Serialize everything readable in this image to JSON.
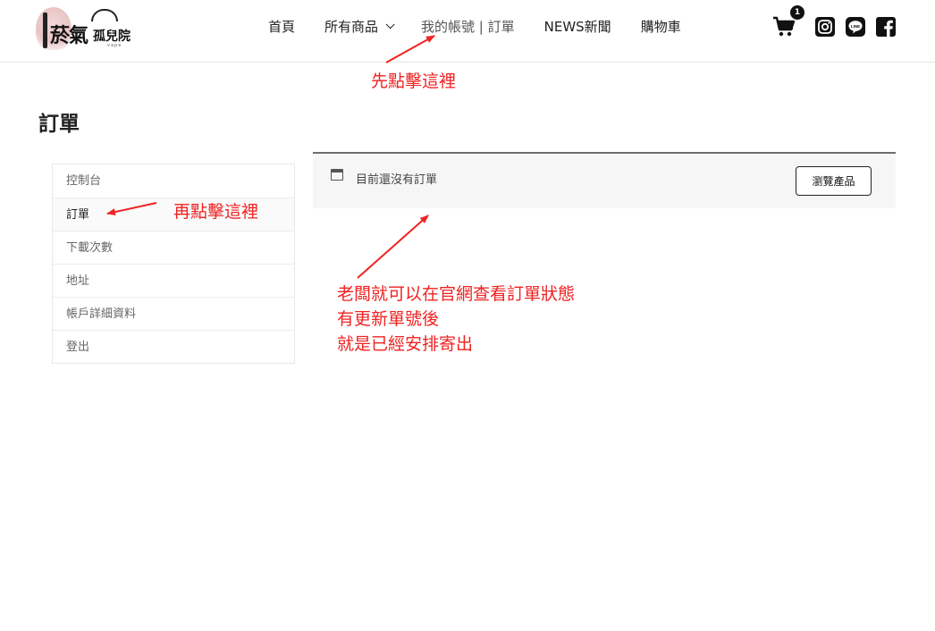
{
  "header": {
    "logo": {
      "title": "菸氣",
      "subtitle": "孤兒院",
      "tagline": "vape"
    },
    "nav": [
      {
        "label": "首頁"
      },
      {
        "label": "所有商品",
        "has_dropdown": true
      },
      {
        "label": "我的帳號 | 訂單",
        "active": true
      },
      {
        "label": "NEWS新聞"
      },
      {
        "label": "購物車"
      }
    ],
    "cart_count": "1",
    "icons": [
      "cart-icon",
      "instagram-icon",
      "line-icon",
      "facebook-icon"
    ]
  },
  "page": {
    "title": "訂單"
  },
  "account_nav": {
    "items": [
      {
        "label": "控制台"
      },
      {
        "label": "訂單",
        "active": true
      },
      {
        "label": "下載次數"
      },
      {
        "label": "地址"
      },
      {
        "label": "帳戶詳細資料"
      },
      {
        "label": "登出"
      }
    ]
  },
  "notice": {
    "message": "目前還沒有訂單",
    "button_label": "瀏覽產品",
    "icon": "window-icon"
  },
  "annotations": {
    "step1": "先點擊這裡",
    "step2": "再點擊這裡",
    "note_line1": "老闆就可以在官網查看訂單狀態",
    "note_line2": "有更新單號後",
    "note_line3": "就是已經安排寄出",
    "color": "#f02222"
  }
}
